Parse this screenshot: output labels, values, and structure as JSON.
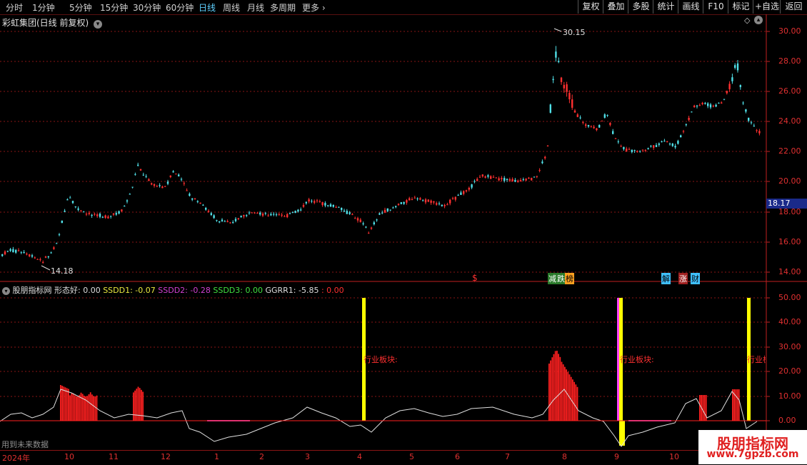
{
  "toolbar": {
    "periods": [
      "分时",
      "1分钟",
      "5分钟",
      "15分钟",
      "30分钟",
      "60分钟",
      "日线",
      "周线",
      "月线",
      "多周期",
      "更多"
    ],
    "active": "日线",
    "right_buttons": [
      "复权",
      "叠加",
      "多股",
      "统计",
      "画线",
      "F10",
      "标记",
      "+自选",
      "返回"
    ]
  },
  "main_chart": {
    "title": "彩虹集团(日线 前复权)",
    "price_ticks": [
      "30.00",
      "28.00",
      "26.00",
      "24.00",
      "22.00",
      "20.00",
      "18.00",
      "16.00",
      "14.00"
    ],
    "current_price": "18.17",
    "high_label": "30.15",
    "low_label": "14.18",
    "event_markers": [
      {
        "text": "$",
        "color": "#ff3030"
      },
      {
        "text": "减",
        "color": "#ff5050"
      },
      {
        "text": "跌",
        "color": "#30c030"
      },
      {
        "text": "榜",
        "color": "#ffa020"
      },
      {
        "text": "解",
        "color": "#40c0ff"
      },
      {
        "text": "涨",
        "color": "#ff3030"
      },
      {
        "text": "财",
        "color": "#40c0ff"
      }
    ]
  },
  "indicator": {
    "name": "股朋指标网",
    "fields": [
      {
        "label": "形态好: 0.00",
        "color": "#dddddd"
      },
      {
        "label": "SSDD1: -0.07",
        "color": "#e8e840"
      },
      {
        "label": "SSDD2: -0.28",
        "color": "#d040d0"
      },
      {
        "label": "SSDD3: 0.00",
        "color": "#40e040"
      },
      {
        "label": "GGRR1: -5.85",
        "color": "#dddddd"
      },
      {
        "label": ": 0.00",
        "color": "#ff3030"
      }
    ],
    "ticks": [
      "50.00",
      "40.00",
      "30.00",
      "20.00",
      "10.00",
      "0.00"
    ],
    "annotations": [
      "行业板块:",
      "行业板块:",
      "行业板"
    ],
    "footer_note": "用到未来数据"
  },
  "time_axis": [
    "2024年",
    "10",
    "11",
    "12",
    "1",
    "2",
    "3",
    "4",
    "5",
    "6",
    "7",
    "8",
    "9",
    "10"
  ],
  "watermark": {
    "name": "股朋指标网",
    "url": "www.7gpzb.com"
  },
  "colors": {
    "up": "#ff3030",
    "down": "#50e0e8",
    "grid": "#8a1414",
    "signal": "#ffff00"
  }
}
